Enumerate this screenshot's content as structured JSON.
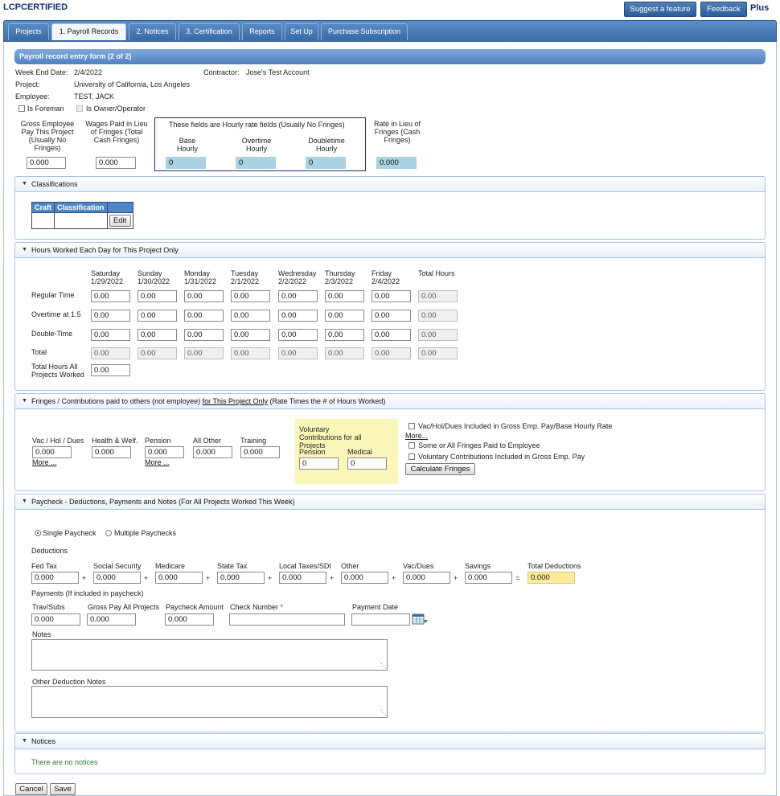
{
  "app": {
    "logo": "LCPCERTIFIED",
    "suggest_label": "Suggest a feature",
    "feedback_label": "Feedback",
    "plus_label": "Plus"
  },
  "tabs": [
    {
      "label": "Projects"
    },
    {
      "label": "1. Payroll Records"
    },
    {
      "label": "2. Notices"
    },
    {
      "label": "3. Certification"
    },
    {
      "label": "Reports"
    },
    {
      "label": "Set Up"
    },
    {
      "label": "Purchase Subscription"
    }
  ],
  "form": {
    "title": "Payroll record entry form (2 of 2)",
    "week_end_label": "Week End Date:",
    "week_end_value": "2/4/2022",
    "contractor_label": "Contractor:",
    "contractor_value": "Jose's Test Account",
    "project_label": "Project:",
    "project_value": "University of California, Los Angeles",
    "employee_label": "Employee:",
    "employee_value": "TEST, JACK",
    "is_foreman_label": "Is Foreman",
    "is_owner_label": "Is Owner/Operator"
  },
  "pay": {
    "gross_label": "Gross Employee Pay This Project (Usually No Fringes)",
    "gross_value": "0.000",
    "wages_lieu_label": "Wages Paid in Lieu of Fringes (Total Cash Fringes)",
    "wages_lieu_value": "0.000",
    "hourly_box_title": "These fields are Hourly rate fields (Usually No Fringes)",
    "base_label": "Base Hourly",
    "base_value": "0",
    "overtime_label": "Overtime Hourly",
    "overtime_value": "0",
    "doubletime_label": "Doubletime Hourly",
    "doubletime_value": "0",
    "rate_lieu_label": "Rate in Lieu of Fringes (Cash Fringes)",
    "rate_lieu_value": "0.000"
  },
  "classifications": {
    "header": "Classifications",
    "col_craft": "Craft",
    "col_classification": "Classification",
    "edit_label": "Edit"
  },
  "hours": {
    "header": "Hours Worked Each Day for This Project Only",
    "days": [
      {
        "name": "Saturday",
        "date": "1/29/2022"
      },
      {
        "name": "Sunday",
        "date": "1/30/2022"
      },
      {
        "name": "Monday",
        "date": "1/31/2022"
      },
      {
        "name": "Tuesday",
        "date": "2/1/2022"
      },
      {
        "name": "Wednesday",
        "date": "2/2/2022"
      },
      {
        "name": "Thursday",
        "date": "2/3/2022"
      },
      {
        "name": "Friday",
        "date": "2/4/2022"
      }
    ],
    "total_hours_label": "Total Hours",
    "rows": [
      {
        "label": "Regular Time",
        "values": [
          "0.00",
          "0.00",
          "0.00",
          "0.00",
          "0.00",
          "0.00",
          "0.00"
        ],
        "total": "0.00"
      },
      {
        "label": "Overtime at 1.5",
        "values": [
          "0.00",
          "0.00",
          "0.00",
          "0.00",
          "0.00",
          "0.00",
          "0.00"
        ],
        "total": "0.00"
      },
      {
        "label": "Double-Time",
        "values": [
          "0.00",
          "0.00",
          "0.00",
          "0.00",
          "0.00",
          "0.00",
          "0.00"
        ],
        "total": "0.00"
      },
      {
        "label": "Total",
        "values": [
          "0.00",
          "0.00",
          "0.00",
          "0.00",
          "0.00",
          "0.00",
          "0.00"
        ],
        "total": "0.00"
      }
    ],
    "all_projects_label": "Total Hours All Projects Worked",
    "all_projects_value": "0.00"
  },
  "fringes": {
    "header_pre": "Fringes / Contributions paid to others (not employee) ",
    "header_link": "for This Project Only",
    "header_post": " (Rate Times the # of Hours Worked)",
    "vac_label": "Vac / Hol / Dues",
    "vac_value": "0.000",
    "health_label": "Health & Welf.",
    "health_value": "0.000",
    "pension_label": "Pension",
    "pension_value": "0.000",
    "all_other_label": "All Other",
    "all_other_value": "0.000",
    "training_label": "Training",
    "training_value": "0.000",
    "more_label": "More ...",
    "voluntary_title": "Voluntary Contributions for all Projects",
    "vol_pension_label": "Pension",
    "vol_pension_value": "0",
    "vol_medical_label": "Medical",
    "vol_medical_value": "0",
    "chk_vac_included": "Vac/Hol/Dues Included in Gross Emp. Pay/Base Hourly Rate",
    "more_link": "More...",
    "chk_some_fringes": "Some or All Fringes Paid to Employee",
    "chk_voluntary_included": "Voluntary Contributions Included in Gross Emp. Pay",
    "calculate_label": "Calculate Fringes"
  },
  "paycheck": {
    "header": "Paycheck - Deductions, Payments and Notes (For All Projects Worked This Week)",
    "single_label": "Single Paycheck",
    "multiple_label": "Multiple Paychecks",
    "deductions_label": "Deductions",
    "deductions": [
      {
        "label": "Fed Tax",
        "value": "0.000"
      },
      {
        "label": "Social Security",
        "value": "0.000"
      },
      {
        "label": "Medicare",
        "value": "0.000"
      },
      {
        "label": "State Tax",
        "value": "0.000"
      },
      {
        "label": "Local Taxes/SDI",
        "value": "0.000"
      },
      {
        "label": "Other",
        "value": "0.000"
      },
      {
        "label": "Vac/Dues",
        "value": "0.000"
      },
      {
        "label": "Savings",
        "value": "0.000"
      }
    ],
    "plus_sign": "+",
    "equals_sign": "=",
    "total_deductions_label": "Total Deductions",
    "total_deductions_value": "0.000",
    "payments_label": "Payments (If included in paycheck)",
    "trav_label": "Trav/Subs",
    "trav_value": "0.000",
    "gross_all_label": "Gross Pay All Projects",
    "gross_all_value": "0.000",
    "paycheck_amount_label": "Paycheck Amount",
    "paycheck_amount_value": "0.000",
    "check_number_label": "Check Number",
    "required_mark": "*",
    "check_number_value": "",
    "payment_date_label": "Payment Date",
    "payment_date_value": "",
    "notes_label": "Notes",
    "other_notes_label": "Other Deduction Notes"
  },
  "notices": {
    "header": "Notices",
    "message": "There are no notices"
  },
  "footer": {
    "cancel_label": "Cancel",
    "save_label": "Save"
  },
  "icons": {
    "collapse": "triangle-down-icon",
    "calendar": "calendar-icon",
    "textarea_grip": "resize-grip-icon"
  },
  "colors": {
    "tab_blue": "#3c6eaa",
    "header_blue": "#4f82c0",
    "readonly_blue": "#a9d3e3",
    "total_yellow": "#fbeb9a",
    "voluntary_yellow": "#fbf7b8",
    "notice_green": "#2f7a2f"
  }
}
